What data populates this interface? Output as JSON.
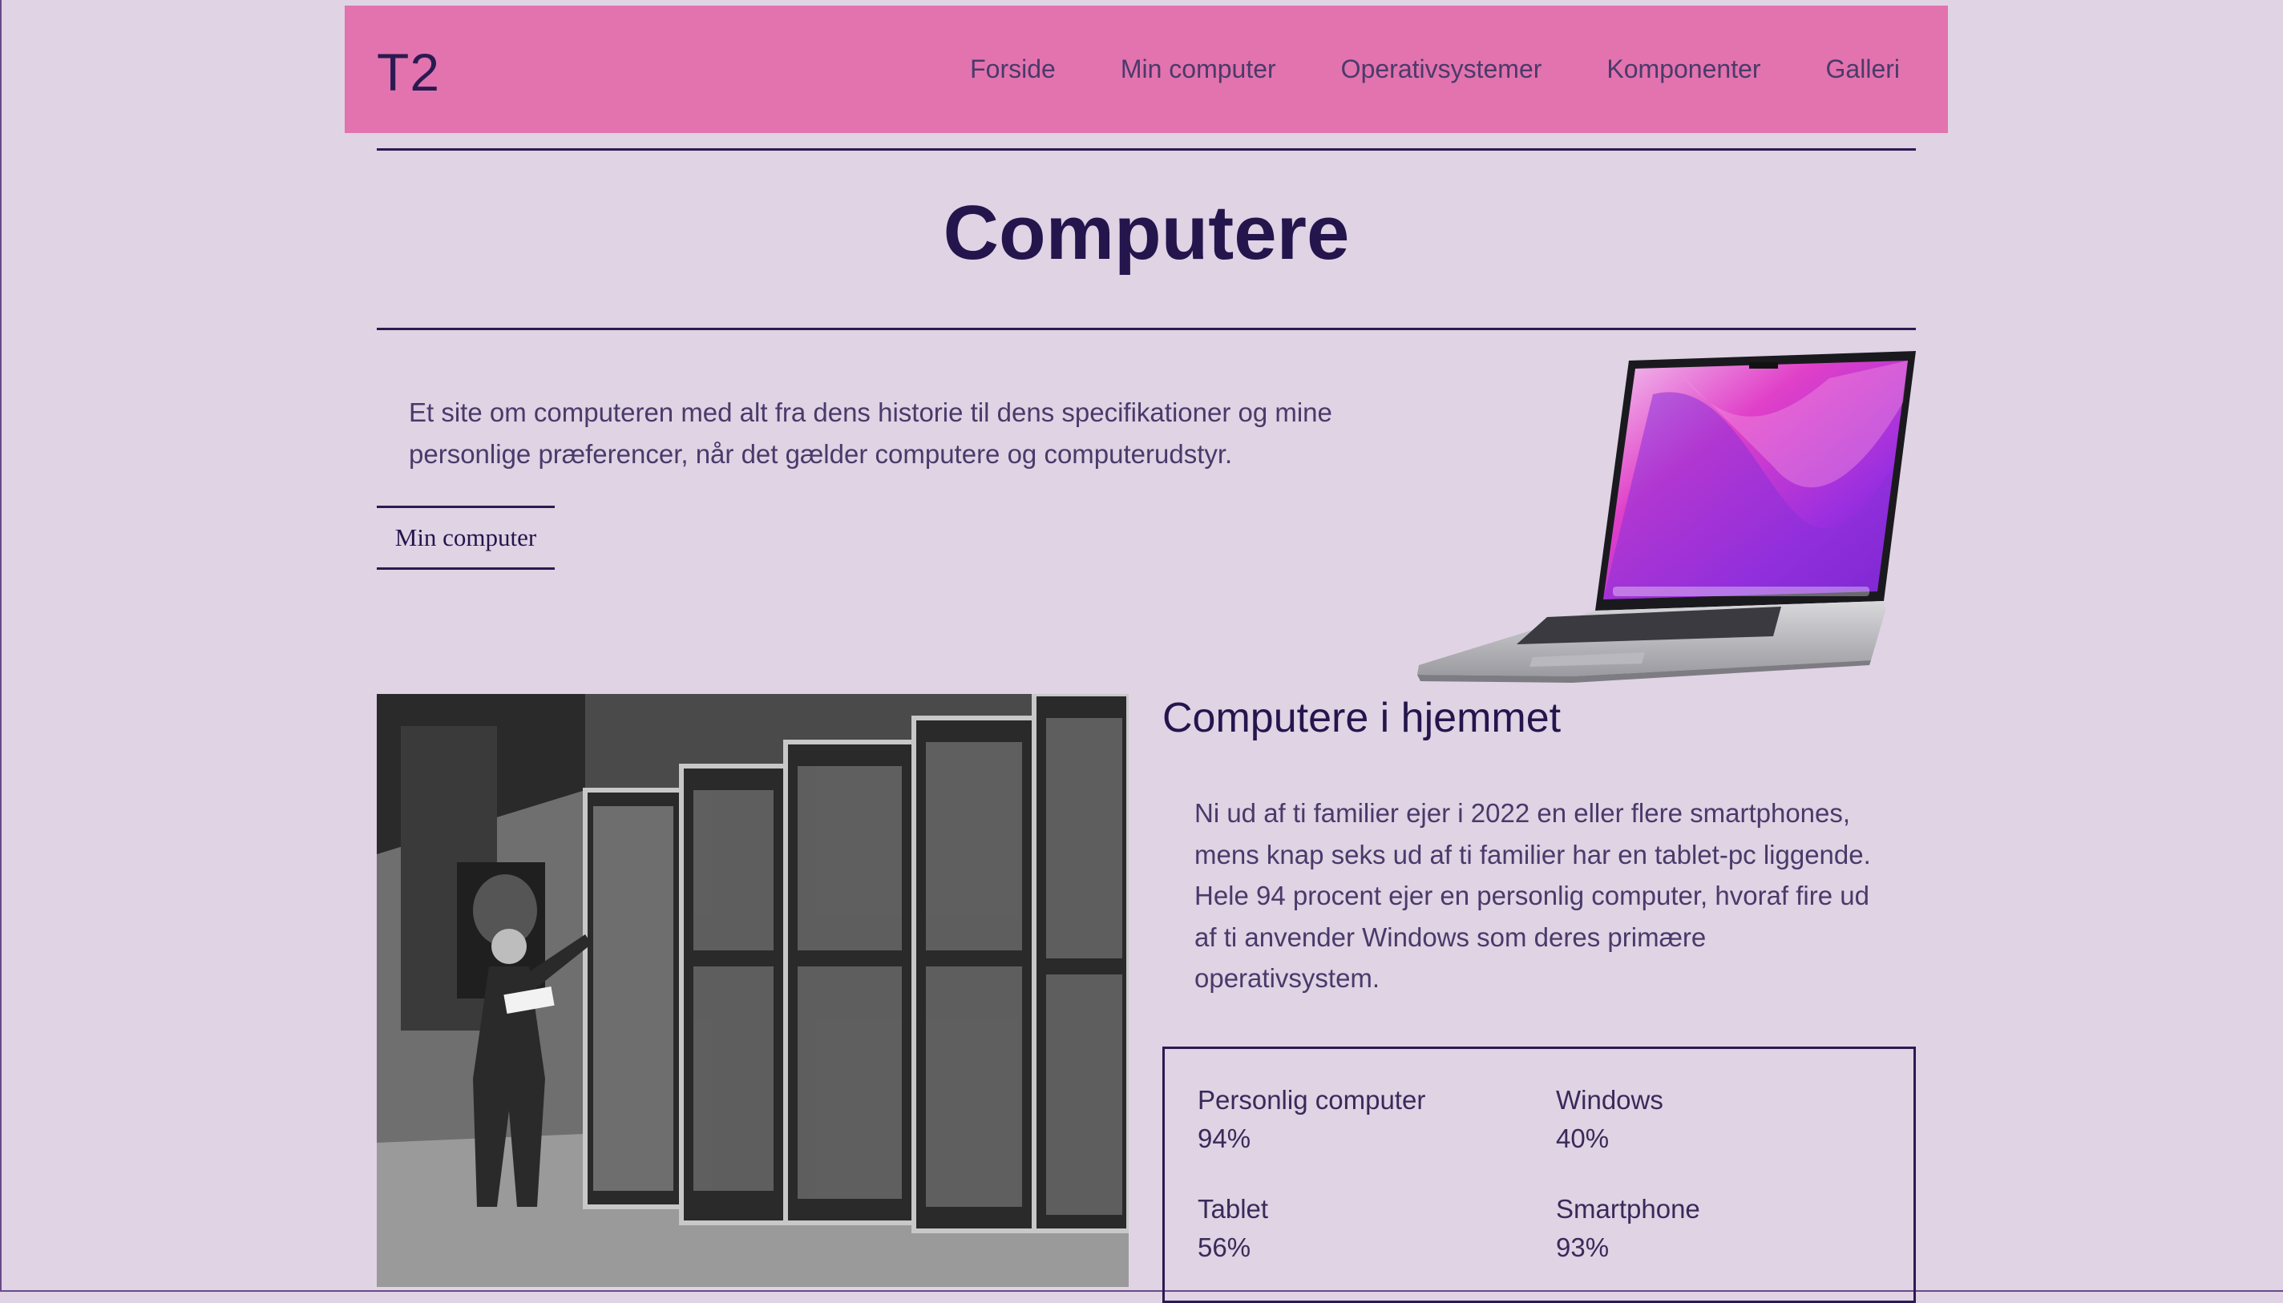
{
  "header": {
    "logo": "T2",
    "nav": [
      "Forside",
      "Min computer",
      "Operativsystemer",
      "Komponenter",
      "Galleri"
    ]
  },
  "hero": {
    "title": "Computere",
    "intro": "Et site om computeren med alt fra dens historie til dens specifikationer og mine personlige præferencer, når det gælder computere og computerudstyr.",
    "cta_label": "Min computer"
  },
  "home_section": {
    "title": "Computere i hjemmet",
    "text": "Ni ud af ti familier ejer i 2022 en eller flere smartphones, mens knap seks ud af ti familier har en tablet-pc liggende. Hele 94 procent ejer en personlig computer, hvoraf fire ud af ti anvender Windows som deres primære operativsystem."
  },
  "stats": [
    {
      "label": "Personlig computer",
      "value": "94%"
    },
    {
      "label": "Windows",
      "value": "40%"
    },
    {
      "label": "Tablet",
      "value": "56%"
    },
    {
      "label": "Smartphone",
      "value": "93%"
    }
  ],
  "colors": {
    "background": "#dfd3e4",
    "header": "#e273ae",
    "text_dark": "#24154d",
    "text_body": "#4a3a6a"
  }
}
